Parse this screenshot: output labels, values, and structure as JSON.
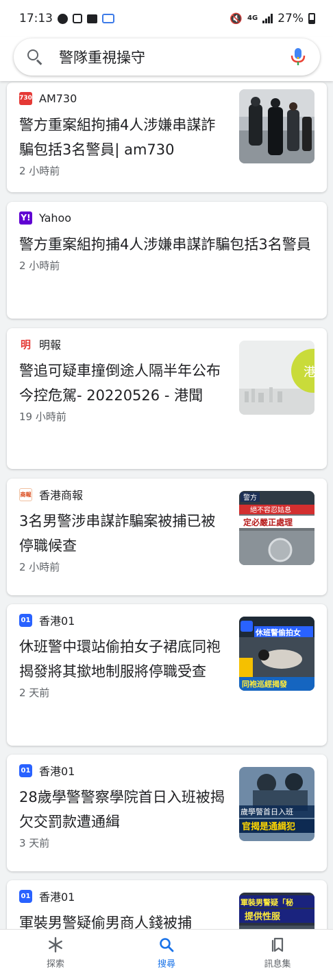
{
  "status_bar": {
    "time": "17:13",
    "network": "4G",
    "battery": "27%"
  },
  "search": {
    "query": "警隊重視操守"
  },
  "colors": {
    "accent": "#1a73e8",
    "text": "#202124",
    "secondary_text": "#5f6368"
  },
  "feed": {
    "cards": [
      {
        "source": "AM730",
        "logo": "730",
        "headline": "警方重案組拘捕4人涉嫌串謀詐騙包括3名警員| am730",
        "time": "2 小時前"
      },
      {
        "source": "Yahoo",
        "logo": "Y!",
        "headline": "警方重案組拘捕4人涉嫌串謀詐騙包括3名警員",
        "time": "2 小時前"
      },
      {
        "source": "明報",
        "logo": "明",
        "headline": "警追可疑車撞倒途人隔半年公布今控危駕- 20220526 - 港聞",
        "time": "19 小時前"
      },
      {
        "source": "香港商報",
        "logo": "商報",
        "headline": "3名男警涉串謀詐騙案被捕已被停職候查",
        "time": "2 小時前",
        "thumb_text_1": "警方",
        "thumb_text_2": "絕不容忍姑息",
        "thumb_text_3": "定必嚴正處理"
      },
      {
        "source": "香港01",
        "logo": "01",
        "headline": "休班警中環站偷拍女子裙底同袍揭發將其撳地制服將停職受查",
        "time": "2 天前",
        "thumb_text_1": "休班警偷拍女",
        "thumb_text_2": "同袍巡經揭發"
      },
      {
        "source": "香港01",
        "logo": "01",
        "headline": "28歲學警警察學院首日入班被揭欠交罰款遭通緝",
        "time": "3 天前",
        "thumb_text_1": "歲學警首日入班",
        "thumb_text_2": "官揭是通緝犯"
      },
      {
        "source": "香港01",
        "logo": "01",
        "headline": "軍裝男警疑偷男商人錢被捕",
        "time": "",
        "thumb_text_1": "軍裝男警疑「秘",
        "thumb_text_2": "提供性服"
      }
    ]
  },
  "bottom_nav": {
    "items": [
      {
        "label": "探索"
      },
      {
        "label": "搜尋"
      },
      {
        "label": "訊息集"
      }
    ]
  }
}
